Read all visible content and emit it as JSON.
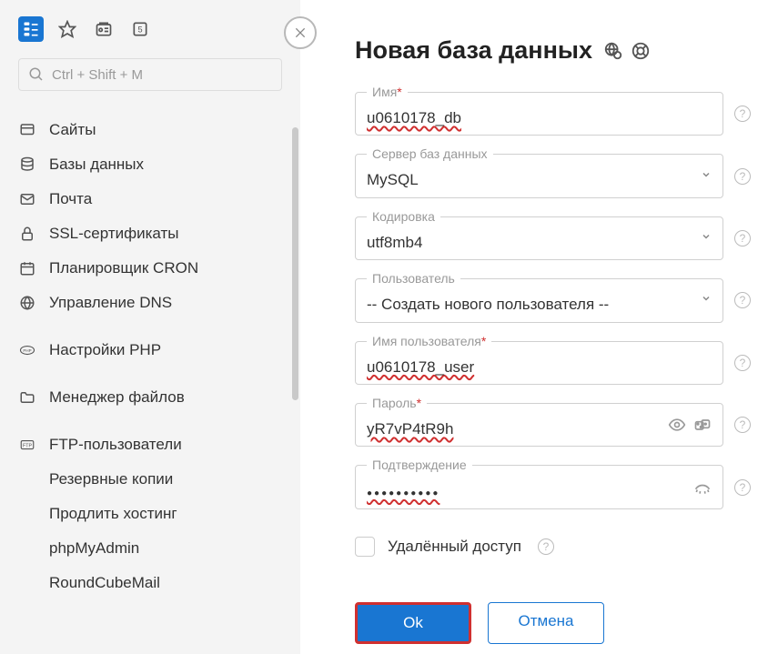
{
  "search": {
    "placeholder": "Ctrl + Shift + M"
  },
  "nav": {
    "sites": "Сайты",
    "databases": "Базы данных",
    "mail": "Почта",
    "ssl": "SSL-сертификаты",
    "cron": "Планировщик CRON",
    "dns": "Управление DNS",
    "php": "Настройки PHP",
    "files": "Менеджер файлов",
    "ftp": "FTP-пользователи",
    "backups": "Резервные копии",
    "extend": "Продлить хостинг",
    "phpmyadmin": "phpMyAdmin",
    "roundcube": "RoundCubeMail"
  },
  "page": {
    "title": "Новая база данных"
  },
  "form": {
    "name": {
      "label": "Имя",
      "value": "u0610178_db"
    },
    "server": {
      "label": "Сервер баз данных",
      "value": "MySQL"
    },
    "encoding": {
      "label": "Кодировка",
      "value": "utf8mb4"
    },
    "user": {
      "label": "Пользователь",
      "value": "-- Создать нового пользователя --"
    },
    "username": {
      "label": "Имя пользователя",
      "value": "u0610178_user"
    },
    "password": {
      "label": "Пароль",
      "value": "yR7vP4tR9h"
    },
    "confirm": {
      "label": "Подтверждение",
      "value": "●●●●●●●●●●"
    },
    "remote": {
      "label": "Удалённый доступ"
    }
  },
  "buttons": {
    "ok": "Ok",
    "cancel": "Отмена"
  }
}
